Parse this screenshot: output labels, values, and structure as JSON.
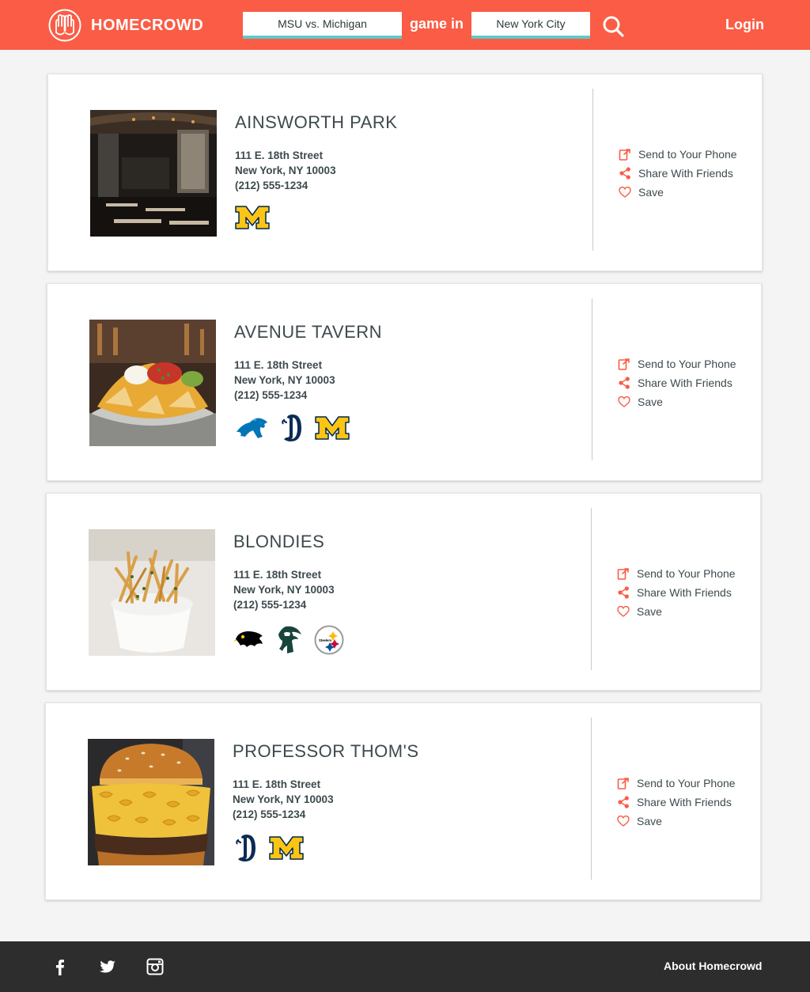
{
  "header": {
    "brand": "HOMECROWD",
    "game_query": "MSU vs. Michigan",
    "connector": "game in",
    "city_query": "New York City",
    "login": "Login",
    "accent": "#fa5c45",
    "field_underline": "#5ecbc9"
  },
  "actions": {
    "send": "Send to Your Phone",
    "share": "Share With Friends",
    "save": "Save"
  },
  "venues": [
    {
      "name": "AINSWORTH PARK",
      "street": "111 E. 18th Street",
      "city": "New York, NY 10003",
      "phone": "(212) 555-1234",
      "teams": [
        "michigan-logo"
      ],
      "photo": "restaurant-interior-photo"
    },
    {
      "name": "AVENUE TAVERN",
      "street": "111 E. 18th Street",
      "city": "New York, NY 10003",
      "phone": "(212) 555-1234",
      "teams": [
        "detroit-lions-logo",
        "detroit-tigers-logo",
        "michigan-logo"
      ],
      "photo": "nachos-photo"
    },
    {
      "name": "BLONDIES",
      "street": "111 E. 18th Street",
      "city": "New York, NY 10003",
      "phone": "(212) 555-1234",
      "teams": [
        "iowa-hawkeyes-logo",
        "michigan-state-spartans-logo",
        "pittsburgh-steelers-logo"
      ],
      "photo": "fries-photo"
    },
    {
      "name": "PROFESSOR THOM'S",
      "street": "111 E. 18th Street",
      "city": "New York, NY 10003",
      "phone": "(212) 555-1234",
      "teams": [
        "detroit-tigers-logo",
        "michigan-logo"
      ],
      "photo": "burger-photo"
    }
  ],
  "footer": {
    "social": [
      "facebook-icon",
      "twitter-icon",
      "instagram-icon"
    ],
    "about": "About Homecrowd"
  }
}
